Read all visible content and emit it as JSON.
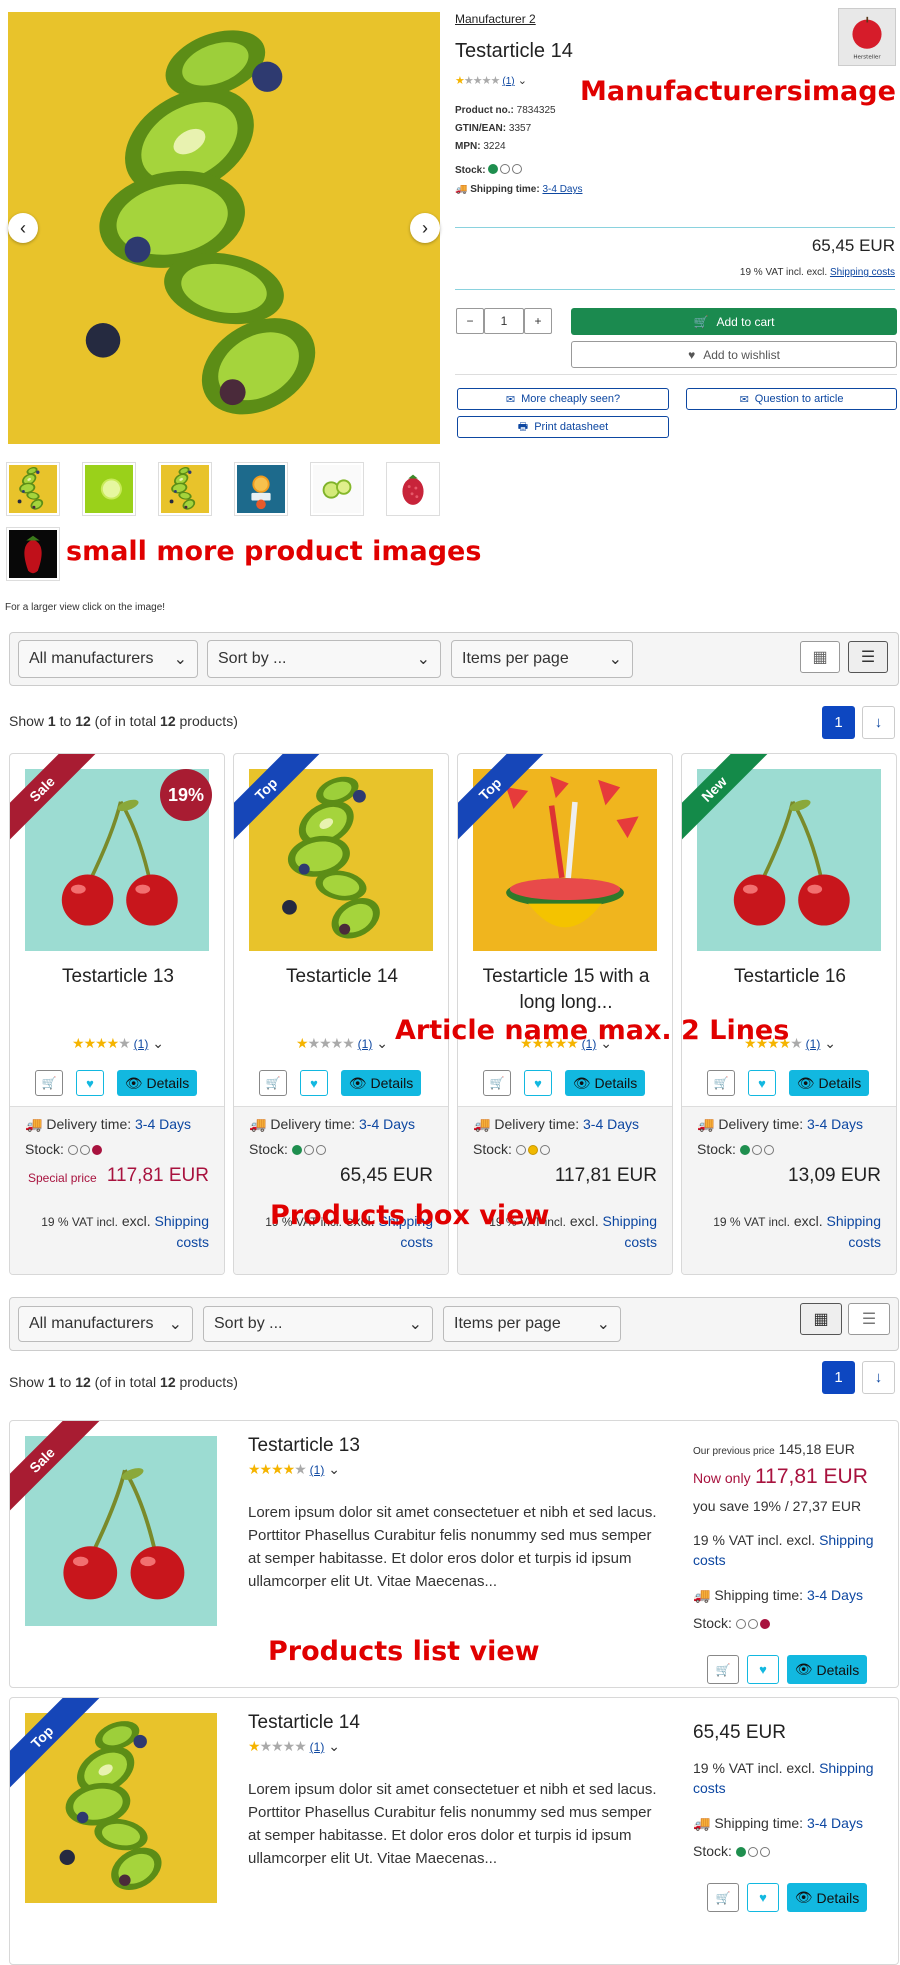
{
  "detail": {
    "manufacturer_link": "Manufacturer 2",
    "title": "Testarticle 14",
    "review_count": "(1)",
    "product_no_label": "Product no.:",
    "product_no": "7834325",
    "gtin_label": "GTIN/EAN:",
    "gtin": "3357",
    "mpn_label": "MPN:",
    "mpn": "3224",
    "stock_label": "Stock:",
    "shipping_label": "Shipping time:",
    "shipping_value": "3-4 Days",
    "price": "65,45 EUR",
    "vat_text": "19 % VAT incl. excl.",
    "shipping_costs": "Shipping costs",
    "qty": "1",
    "qty_minus": "−",
    "qty_plus": "+",
    "add_to_cart": "Add to cart",
    "add_to_wishlist": "Add to wishlist",
    "more_cheaply": "More cheaply seen?",
    "question": "Question to article",
    "datasheet": "Print datasheet",
    "larger_view": "For a larger view click on the image!",
    "manufacturer_logo_text": "Hersteller",
    "prev_icon": "chevron-left",
    "next_icon": "chevron-right"
  },
  "annotations": {
    "manufacturers_image": "Manufacturersimage",
    "small_images": "small more product images",
    "article_name": "Article name max. 2 Lines",
    "box_view": "Products box view",
    "list_view": "Products list view"
  },
  "toolbar": {
    "manufacturers": "All manufacturers",
    "sort": "Sort by ...",
    "per_page": "Items per page",
    "show_prefix": "Show ",
    "from": "1",
    "to_word": " to ",
    "to": "12",
    "of_prefix": " (of in total ",
    "total": "12",
    "of_suffix": " products)",
    "page": "1"
  },
  "box_products": [
    {
      "name": "Testarticle 13",
      "ribbon": "Sale",
      "discount": "19%",
      "reviews": "(1)",
      "delivery_label": "Delivery time:",
      "delivery": "3-4 Days",
      "stock_label": "Stock:",
      "special_label": "Special price",
      "price": "117,81 EUR",
      "vat": "19 % VAT incl.",
      "excl": "excl.",
      "shipping": "Shipping costs",
      "details": "Details"
    },
    {
      "name": "Testarticle 14",
      "ribbon": "Top",
      "reviews": "(1)",
      "delivery_label": "Delivery time:",
      "delivery": "3-4 Days",
      "stock_label": "Stock:",
      "price": "65,45 EUR",
      "vat": "19 % VAT incl.",
      "excl": "excl.",
      "shipping": "Shipping costs",
      "details": "Details"
    },
    {
      "name": "Testarticle 15 with a long long...",
      "ribbon": "Top",
      "reviews": "(1)",
      "delivery_label": "Delivery time:",
      "delivery": "3-4 Days",
      "stock_label": "Stock:",
      "price": "117,81 EUR",
      "vat": "19 % VAT incl.",
      "excl": "excl.",
      "shipping": "Shipping costs",
      "details": "Details"
    },
    {
      "name": "Testarticle 16",
      "ribbon": "New",
      "reviews": "(1)",
      "delivery_label": "Delivery time:",
      "delivery": "3-4 Days",
      "stock_label": "Stock:",
      "price": "13,09 EUR",
      "vat": "19 % VAT incl.",
      "excl": "excl.",
      "shipping": "Shipping costs",
      "details": "Details"
    }
  ],
  "list_products": [
    {
      "name": "Testarticle 13",
      "ribbon": "Sale",
      "desc": "Lorem ipsum dolor sit amet consectetuer et nibh et sed lacus. Porttitor Phasellus Curabitur felis nonummy sed mus semper at semper habitasse. Et dolor eros dolor et turpis id ipsum ullamcorper elit Ut. Vitae Maecenas...",
      "prev_label": "Our previous price",
      "prev_price": "145,18 EUR",
      "now_label": "Now only",
      "price": "117,81 EUR",
      "save": "you save 19% / 27,37 EUR",
      "vat": "19 % VAT incl. excl.",
      "shipping": "Shipping costs",
      "ship_label": "Shipping time:",
      "ship_value": "3-4 Days",
      "stock_label": "Stock:",
      "details": "Details"
    },
    {
      "name": "Testarticle 14",
      "ribbon": "Top",
      "desc": "Lorem ipsum dolor sit amet consectetuer et nibh et sed lacus. Porttitor Phasellus Curabitur felis nonummy sed mus semper at semper habitasse. Et dolor eros dolor et turpis id ipsum ullamcorper elit Ut. Vitae Maecenas...",
      "price": "65,45 EUR",
      "vat": "19 % VAT incl. excl.",
      "shipping": "Shipping costs",
      "ship_label": "Shipping time:",
      "ship_value": "3-4 Days",
      "stock_label": "Stock:",
      "details": "Details"
    }
  ],
  "colors": {
    "green": "#1b8a4f",
    "cyan": "#12b8e0",
    "blue": "#0d47a1",
    "sale": "#a81c32",
    "top": "#1646b8",
    "new": "#148a49",
    "annotation": "#e00000"
  }
}
